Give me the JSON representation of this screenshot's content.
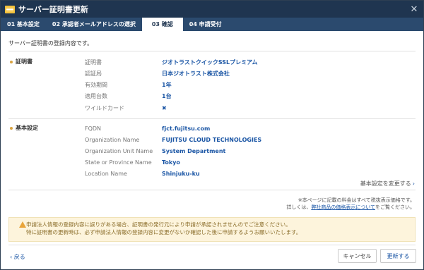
{
  "titlebar": {
    "title": "サーバー証明書更新",
    "close": "✕"
  },
  "tabs": [
    {
      "label": "01 基本設定",
      "active": false
    },
    {
      "label": "02 承認者メールアドレスの選択",
      "active": false
    },
    {
      "label": "03 確認",
      "active": true
    },
    {
      "label": "04 申請受付",
      "active": false
    }
  ],
  "lead": "サーバー証明書の登録内容です。",
  "cert_section": {
    "label": "証明書",
    "rows": [
      {
        "key": "証明書",
        "value": "ジオトラストクイックSSLプレミアム"
      },
      {
        "key": "認証局",
        "value": "日本ジオトラスト株式会社"
      },
      {
        "key": "有効期間",
        "value": "1年"
      },
      {
        "key": "適用台数",
        "value": "1台"
      },
      {
        "key": "ワイルドカード",
        "value": "✖"
      }
    ]
  },
  "basic_section": {
    "label": "基本設定",
    "rows": [
      {
        "key": "FQDN",
        "value": "fjct.fujitsu.com"
      },
      {
        "key": "Organization Name",
        "value": "FUJITSU CLOUD TECHNOLOGIES"
      },
      {
        "key": "Organization Unit Name",
        "value": "System Department"
      },
      {
        "key": "State or Province Name",
        "value": "Tokyo"
      },
      {
        "key": "Location Name",
        "value": "Shinjuku-ku"
      }
    ]
  },
  "change_link": {
    "label": "基本設定を変更する",
    "chev": "›"
  },
  "note": {
    "line1": "※本ページに記載の料金はすべて税抜表示価格です。",
    "line2_prefix": "詳しくは、",
    "line2_link": "弊社商品の価格表示について",
    "line2_suffix": "をご覧ください。"
  },
  "warning": {
    "line1": "申請法人情報の登録内容に誤りがある場合、証明書の発行元により申請が承認されませんのでご注意ください。",
    "line2": "特に証明書の更新時は、必ず申請法人情報の登録内容に変更がないか確認した後に申請するようお願いいたします。"
  },
  "footer": {
    "back": "‹ 戻る",
    "cancel": "キャンセル",
    "update": "更新する"
  }
}
